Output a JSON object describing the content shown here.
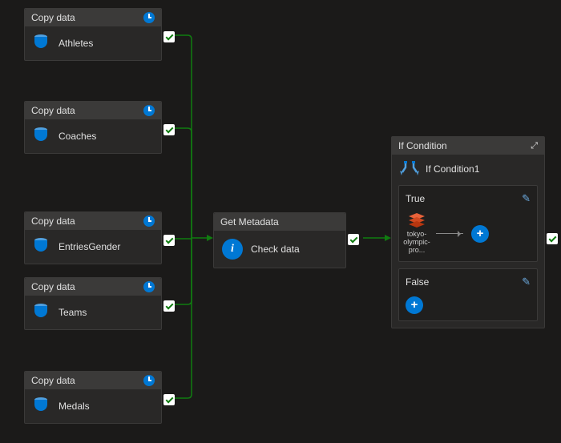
{
  "copy_nodes": [
    {
      "header": "Copy data",
      "label": "Athletes"
    },
    {
      "header": "Copy data",
      "label": "Coaches"
    },
    {
      "header": "Copy data",
      "label": "EntriesGender"
    },
    {
      "header": "Copy data",
      "label": "Teams"
    },
    {
      "header": "Copy data",
      "label": "Medals"
    }
  ],
  "metadata_node": {
    "header": "Get Metadata",
    "label": "Check data"
  },
  "if_node": {
    "header": "If Condition",
    "sub_label": "If Condition1",
    "true_branch": {
      "title": "True",
      "item_label": "tokyo-olympic-pro..."
    },
    "false_branch": {
      "title": "False"
    }
  }
}
